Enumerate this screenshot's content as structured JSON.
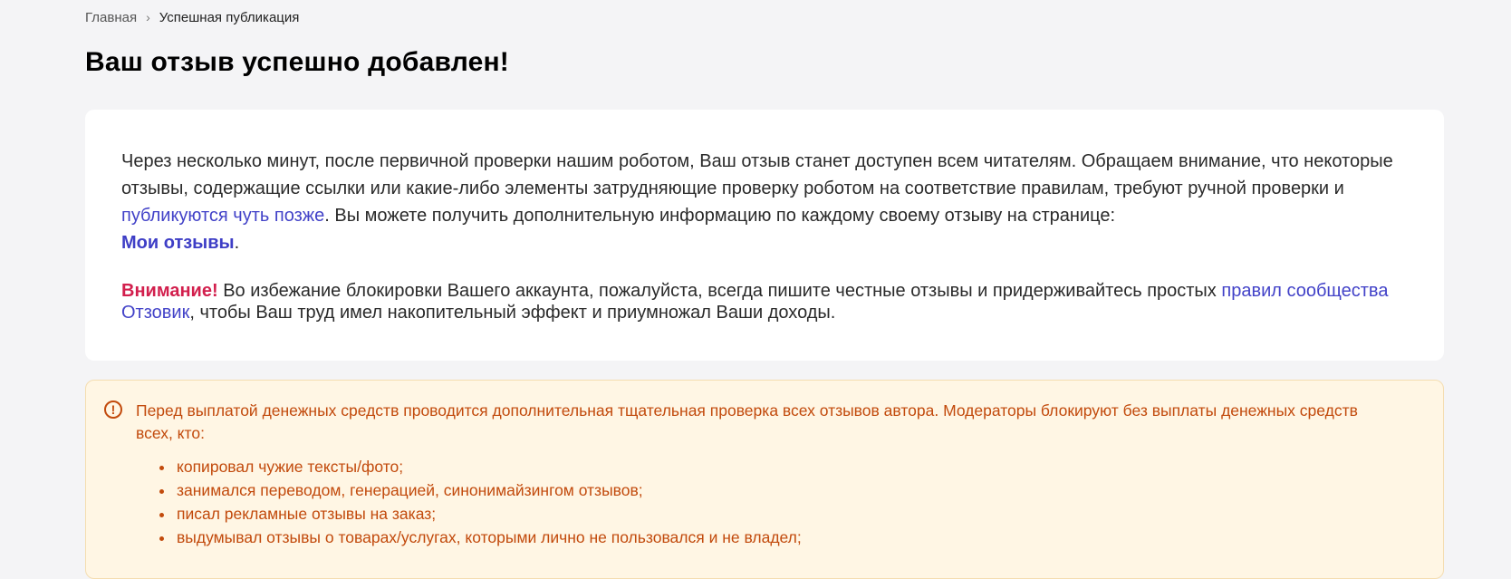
{
  "breadcrumb": {
    "home": "Главная",
    "separator": "›",
    "current": "Успешная публикация"
  },
  "title": "Ваш отзыв успешно добавлен!",
  "card": {
    "p1_part1": "Через несколько минут, после первичной проверки нашим роботом, Ваш отзыв станет доступен всем читателям. Обращаем внимание, что некоторые отзывы, содержащие ссылки или какие-либо элементы затрудняющие проверку роботом на соответствие правилам, требуют ручной проверки и ",
    "p1_link": "публикуются чуть позже",
    "p1_part2": ". Вы можете получить дополнительную информацию по каждому своему отзыву на странице:",
    "my_reviews_link": "Мои отзывы",
    "p1_end": ".",
    "warning_label": "Внимание!",
    "p2_part1": " Во избежание блокировки Вашего аккаунта, пожалуйста, всегда пишите честные отзывы и придерживайтесь простых ",
    "p2_link": "правил сообщества Отзовик",
    "p2_part2": ", чтобы Ваш труд имел накопительный эффект и приумножал Ваши доходы."
  },
  "notice": {
    "icon": "exclamation-circle-icon",
    "icon_glyph": "!",
    "text": "Перед выплатой денежных средств проводится дополнительная тщательная проверка всех отзывов автора. Модераторы блокируют без выплаты денежных средств всех, кто:",
    "items": [
      "копировал чужие тексты/фото;",
      "занимался переводом, генерацией, синонимайзингом отзывов;",
      "писал рекламные отзывы на заказ;",
      "выдумывал отзывы о товарах/услугах, которыми лично не пользовался и не владел;"
    ]
  },
  "colors": {
    "accent_link": "#4242c8",
    "warning": "#d21f4d",
    "notice_text": "#c24a0c",
    "notice_bg": "#fff6e4"
  }
}
